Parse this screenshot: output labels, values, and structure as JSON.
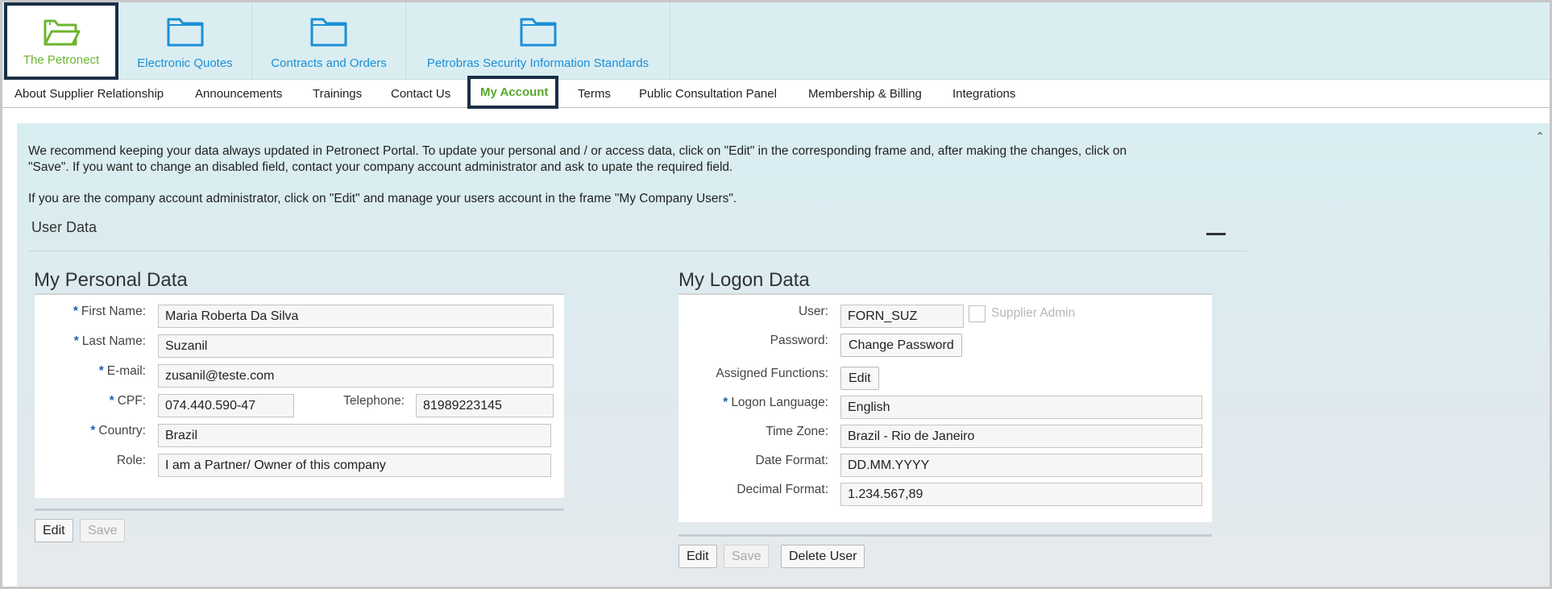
{
  "top_tabs": [
    {
      "label": "The Petronect",
      "icon": "folder-open-icon",
      "active": true
    },
    {
      "label": "Electronic Quotes",
      "icon": "folder-icon"
    },
    {
      "label": "Contracts and Orders",
      "icon": "folder-icon"
    },
    {
      "label": "Petrobras Security Information Standards",
      "icon": "folder-icon"
    }
  ],
  "sub_nav": [
    {
      "label": "About Supplier Relationship"
    },
    {
      "label": "Announcements"
    },
    {
      "label": "Trainings"
    },
    {
      "label": "Contact Us"
    },
    {
      "label": "My Account",
      "active": true
    },
    {
      "label": "Terms"
    },
    {
      "label": "Public Consultation Panel"
    },
    {
      "label": "Membership & Billing"
    },
    {
      "label": "Integrations"
    }
  ],
  "intro": {
    "line1": "We recommend keeping your data always updated in Petronect Portal. To update your personal and / or access data, click on \"Edit\" in the corresponding frame and, after making the changes, click on",
    "line2": "\"Save\". If you want to change an disabled field, contact your company account administrator and ask to upate the required field.",
    "line3": "If you are the company account administrator, click on \"Edit\" and manage your users account in the frame \"My Company Users\"."
  },
  "user_data": {
    "title": "User Data",
    "personal": {
      "title": "My Personal Data",
      "first_name_label": "First Name:",
      "first_name": "Maria Roberta Da Silva",
      "last_name_label": "Last Name:",
      "last_name": "Suzanil",
      "email_label": "E-mail:",
      "email": "zusanil@teste.com",
      "cpf_label": "CPF:",
      "cpf": "074.440.590-47",
      "telephone_label": "Telephone:",
      "telephone": "81989223145",
      "country_label": "Country:",
      "country": "Brazil",
      "role_label": "Role:",
      "role": "I am a Partner/ Owner of this company",
      "edit": "Edit",
      "save": "Save"
    },
    "logon": {
      "title": "My Logon Data",
      "user_label": "User:",
      "user": "FORN_SUZ",
      "supplier_admin_label": "Supplier Admin",
      "password_label": "Password:",
      "change_password": "Change Password",
      "assigned_functions_label": "Assigned Functions:",
      "assigned_edit": "Edit",
      "logon_language_label": "Logon Language:",
      "logon_language": "English",
      "time_zone_label": "Time Zone:",
      "time_zone": "Brazil - Rio de Janeiro",
      "date_format_label": "Date Format:",
      "date_format": "DD.MM.YYYY",
      "decimal_format_label": "Decimal Format:",
      "decimal_format": "1.234.567,89",
      "edit": "Edit",
      "save": "Save",
      "delete_user": "Delete User"
    }
  },
  "required_marker": "*",
  "colors": {
    "accent_green": "#6cb52d",
    "link_blue": "#1b8fd6",
    "highlight_border": "#1a2f45"
  }
}
